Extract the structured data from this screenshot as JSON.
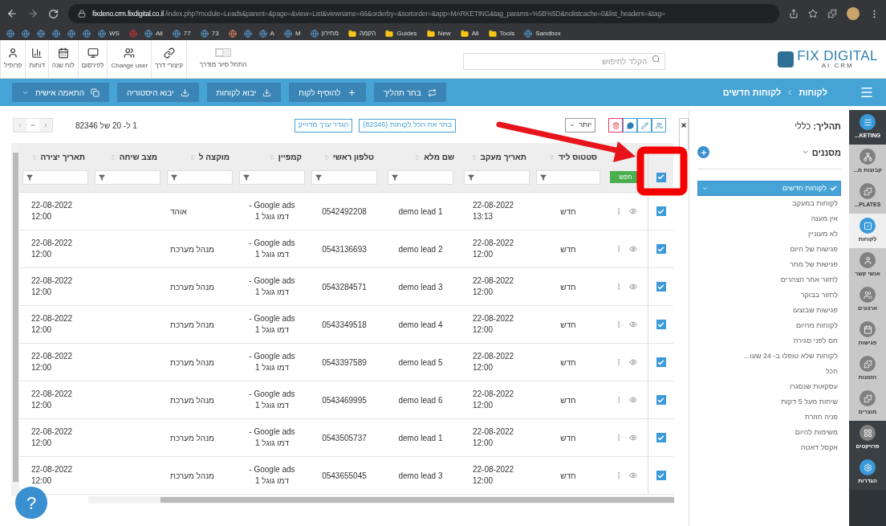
{
  "browser": {
    "url_host": "fixdeno.crm.fixdigital.co.il",
    "url_path": "/index.php?module=Leads&parent=&page=&view=List&viewname=66&orderby=&sortorder=&app=MARKETING&tag_params=%5B%5D&nolistcache=0&list_headers=&tag=",
    "bookmarks": [
      {
        "kind": "site",
        "label": "Sandbox"
      },
      {
        "kind": "folder",
        "label": "Tools"
      },
      {
        "kind": "folder",
        "label": "All"
      },
      {
        "kind": "folder",
        "label": "New"
      },
      {
        "kind": "folder",
        "label": "Guides"
      },
      {
        "kind": "folder",
        "label": "הקמה"
      },
      {
        "kind": "site",
        "label": "מחירון"
      },
      {
        "kind": "site",
        "label": "M"
      },
      {
        "kind": "site",
        "label": "A"
      },
      {
        "kind": "site",
        "label": "73"
      },
      {
        "kind": "site",
        "label": "77"
      },
      {
        "kind": "site",
        "label": "All"
      },
      {
        "kind": "site",
        "label": "WS"
      }
    ]
  },
  "toolbar": {
    "tour_toggle": {
      "label": "התחל סיור מודרך",
      "on": false
    },
    "items": [
      {
        "label": "קיצורי דרך"
      },
      {
        "label": "Change user"
      },
      {
        "label": "לפירסום"
      },
      {
        "label": "לוח שנה"
      },
      {
        "label": "דוחות"
      },
      {
        "label": "פרופיל"
      }
    ]
  },
  "search": {
    "placeholder": "הקלד לחיפוש"
  },
  "logo": {
    "name": "FIX DIGITAL",
    "tagline": "AI CRM"
  },
  "action_bar": {
    "breadcrumb": [
      "לקוחות",
      "לקוחות חדשים"
    ],
    "buttons": [
      {
        "label": "בחר תהליך"
      },
      {
        "label": "להוסיף לקוח"
      },
      {
        "label": "יבוא לקוחות"
      },
      {
        "label": "יבוא היסטוריה"
      },
      {
        "label": "התאמה אישית"
      }
    ]
  },
  "list": {
    "range": "1 ל- 20 של 82346",
    "select_all": "בחר את הכל לקוחות (82346)",
    "set_exact": "הגדר ערך מדוייק",
    "more": "יותר"
  },
  "table": {
    "header_checked": true,
    "search_button": "חפש",
    "columns": [
      "סטטוס ליד",
      "תאריך מעקב",
      "שם מלא",
      "טלפון ראשי",
      "קמפיין",
      "מוקצה ל",
      "מצב שיחה",
      "תאריך יצירה"
    ],
    "rows": [
      {
        "selected": true,
        "status": "חדש",
        "follow_up": "22-08-2022 13:13",
        "name": "demo lead 1",
        "phone": "0542492208",
        "campaign": "Google ads - דמו גוגל 1",
        "assigned": "אוהד",
        "created": "22-08-2022 12:00"
      },
      {
        "selected": true,
        "status": "חדש",
        "follow_up": "22-08-2022 12:00",
        "name": "demo lead 2",
        "phone": "0543136693",
        "campaign": "Google ads - דמו גוגל 1",
        "assigned": "מנהל מערכת",
        "created": "22-08-2022 12:00"
      },
      {
        "selected": true,
        "status": "חדש",
        "follow_up": "22-08-2022 12:00",
        "name": "demo lead 3",
        "phone": "0543284571",
        "campaign": "Google ads - דמו גוגל 1",
        "assigned": "מנהל מערכת",
        "created": "22-08-2022 12:00"
      },
      {
        "selected": true,
        "status": "חדש",
        "follow_up": "22-08-2022 12:00",
        "name": "demo lead 4",
        "phone": "0543349518",
        "campaign": "Google ads - דמו גוגל 1",
        "assigned": "מנהל מערכת",
        "created": "22-08-2022 12:00"
      },
      {
        "selected": true,
        "status": "חדש",
        "follow_up": "22-08-2022 12:00",
        "name": "demo lead 5",
        "phone": "0543397589",
        "campaign": "Google ads - דמו גוגל 1",
        "assigned": "מנהל מערכת",
        "created": "22-08-2022 12:00"
      },
      {
        "selected": true,
        "status": "חדש",
        "follow_up": "22-08-2022 12:00",
        "name": "demo lead 6",
        "phone": "0543469995",
        "campaign": "Google ads - דמו גוגל 1",
        "assigned": "מנהל מערכת",
        "created": "22-08-2022 12:00"
      },
      {
        "selected": true,
        "status": "חדש",
        "follow_up": "22-08-2022 12:00",
        "name": "demo lead 1",
        "phone": "0543505737",
        "campaign": "Google ads - דמו גוגל 1",
        "assigned": "מנהל מערכת",
        "created": "22-08-2022 12:00"
      },
      {
        "selected": true,
        "status": "חדש",
        "follow_up": "22-08-2022 12:00",
        "name": "demo lead 3",
        "phone": "0543655045",
        "campaign": "Google ads - דמו גוגל 1",
        "assigned": "מנהל מערכת",
        "created": "22-08-2022 12:00"
      }
    ]
  },
  "sidebar": {
    "process": "**תהליך:** כללי",
    "filters_label": "מסננים",
    "filters": [
      {
        "label": "לקוחות חדשים",
        "selected": true
      },
      {
        "label": "לקוחות במעקב",
        "selected": false
      },
      {
        "label": "אין מענה",
        "selected": false
      },
      {
        "label": "לא מעוניין",
        "selected": false
      },
      {
        "label": "פגישות של היום",
        "selected": false
      },
      {
        "label": "פגישות של מחר",
        "selected": false
      },
      {
        "label": "לחזור אחר הצהרים",
        "selected": false
      },
      {
        "label": "לחזור בבוקר",
        "selected": false
      },
      {
        "label": "פגישות שבוצעו",
        "selected": false
      },
      {
        "label": "לקוחות מהיום",
        "selected": false
      },
      {
        "label": "חם לפני סגירה",
        "selected": false
      },
      {
        "label": "לקוחות שלא טופלו ב- 24 שעו...",
        "selected": false
      },
      {
        "label": "הכל",
        "selected": false
      },
      {
        "label": "עסקאות שנסגרו",
        "selected": false
      },
      {
        "label": "שיחות מעל 5 דקות",
        "selected": false
      },
      {
        "label": "פניה חוזרת",
        "selected": false
      },
      {
        "label": "משימות להיום",
        "selected": false
      },
      {
        "label": "אקסל דאטה",
        "selected": false
      }
    ]
  },
  "rail": [
    {
      "label": "...KETING",
      "kind": "dark",
      "selected": false
    },
    {
      "label": "קבוצות מ...",
      "kind": "plain",
      "selected": false
    },
    {
      "label": "...PLATES",
      "kind": "plain",
      "selected": false
    },
    {
      "label": "לקוחות",
      "kind": "plain",
      "selected": true
    },
    {
      "label": "אנשי קשר",
      "kind": "plain",
      "selected": false
    },
    {
      "label": "ארגונים",
      "kind": "plain",
      "selected": false
    },
    {
      "label": "פגישות",
      "kind": "plain",
      "selected": false
    },
    {
      "label": "הזמנות",
      "kind": "plain",
      "selected": false
    },
    {
      "label": "מוצרים",
      "kind": "plain",
      "selected": false
    },
    {
      "label": "פרויקטים",
      "kind": "dark",
      "selected": false
    },
    {
      "label": "הגדרות",
      "kind": "dark",
      "selected": false
    }
  ],
  "help": {
    "label": "?"
  }
}
